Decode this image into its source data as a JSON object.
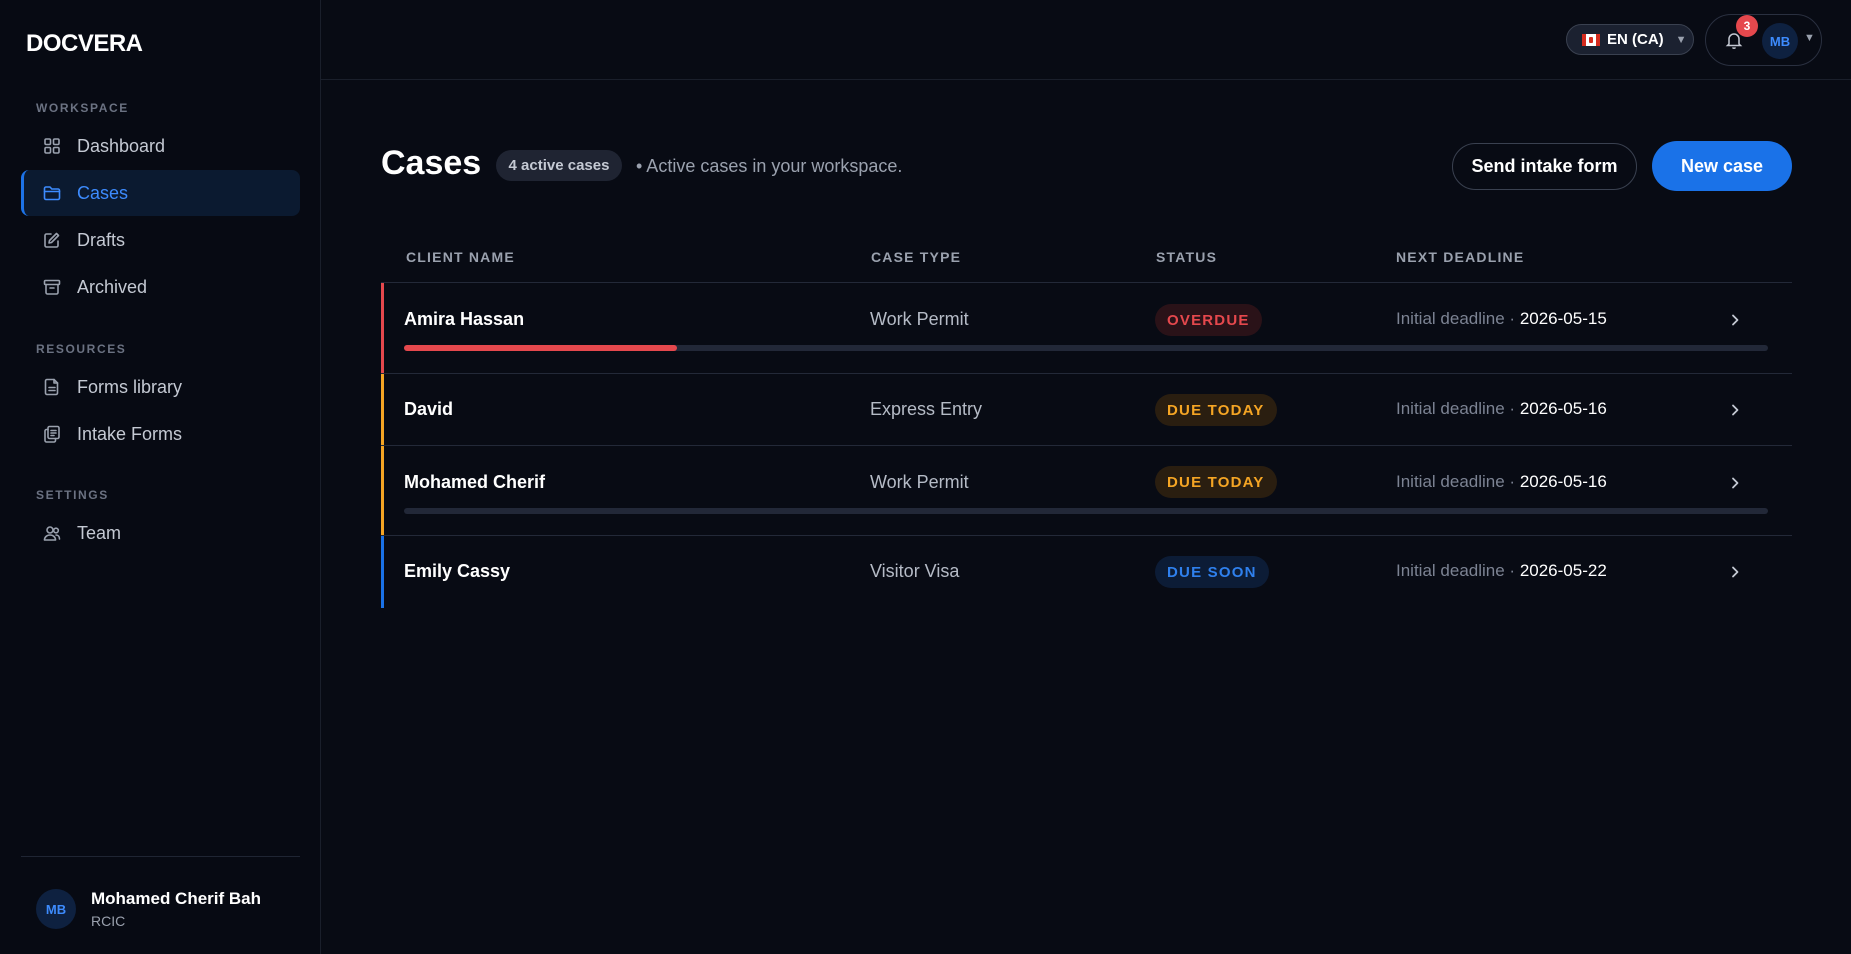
{
  "app": {
    "logo": "DOCVERA"
  },
  "sidebar": {
    "sections": [
      {
        "label": "WORKSPACE",
        "items": [
          {
            "label": "Dashboard",
            "icon": "grid-icon"
          },
          {
            "label": "Cases",
            "icon": "folder-icon",
            "active": true
          },
          {
            "label": "Drafts",
            "icon": "pencil-icon"
          },
          {
            "label": "Archived",
            "icon": "archive-box-icon"
          }
        ]
      },
      {
        "label": "RESOURCES",
        "items": [
          {
            "label": "Forms library",
            "icon": "document-icon"
          },
          {
            "label": "Intake Forms",
            "icon": "clipboard-copy-icon"
          }
        ]
      },
      {
        "label": "SETTINGS",
        "items": [
          {
            "label": "Team",
            "icon": "users-icon"
          }
        ]
      }
    ],
    "user": {
      "initials": "MB",
      "name": "Mohamed Cherif Bah",
      "role": "RCIC"
    }
  },
  "topbar": {
    "language": "EN (CA)",
    "flag": "canada-flag-icon",
    "notifications_count": "3",
    "avatar_initials": "MB"
  },
  "page": {
    "title": "Cases",
    "count_badge": "4 active cases",
    "subtitle": "• Active cases in your workspace.",
    "send_intake_label": "Send intake form",
    "new_case_label": "New case"
  },
  "table": {
    "columns": [
      "CLIENT NAME",
      "CASE TYPE",
      "STATUS",
      "NEXT DEADLINE"
    ],
    "deadline_label": "Initial deadline · ",
    "rows": [
      {
        "client": "Amira Hassan",
        "case_type": "Work Permit",
        "status": "OVERDUE",
        "deadline": "2026-05-15",
        "accent": "#e5484d",
        "progress": 0.2
      },
      {
        "client": "David",
        "case_type": "Express Entry",
        "status": "DUE TODAY",
        "deadline": "2026-05-16",
        "accent": "#f5a524"
      },
      {
        "client": "Mohamed Cherif",
        "case_type": "Work Permit",
        "status": "DUE TODAY",
        "deadline": "2026-05-16",
        "accent": "#f5a524",
        "progress": 0
      },
      {
        "client": "Emily Cassy",
        "case_type": "Visitor Visa",
        "status": "DUE SOON",
        "deadline": "2026-05-22",
        "accent": "#1a72e8"
      }
    ]
  },
  "colors": {
    "primary": "#1a72e8",
    "overdue": "#e5484d",
    "due_today": "#f5a524",
    "due_soon": "#1a72e8",
    "background": "#080b14"
  }
}
